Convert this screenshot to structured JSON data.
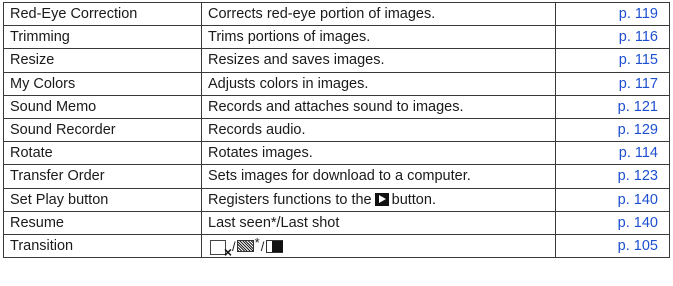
{
  "rows": [
    {
      "function": "Red-Eye Correction",
      "description": "Corrects red-eye portion of images.",
      "page": "p. 119"
    },
    {
      "function": "Trimming",
      "description": "Trims portions of images.",
      "page": "p. 116"
    },
    {
      "function": "Resize",
      "description": "Resizes and saves images.",
      "page": "p. 115"
    },
    {
      "function": "My Colors",
      "description": "Adjusts colors in images.",
      "page": "p. 117"
    },
    {
      "function": "Sound Memo",
      "description": "Records and attaches sound to images.",
      "page": "p. 121"
    },
    {
      "function": "Sound Recorder",
      "description": "Records audio.",
      "page": "p. 129"
    },
    {
      "function": "Rotate",
      "description": "Rotates images.",
      "page": "p. 114"
    },
    {
      "function": "Transfer Order",
      "description": "Sets images for download to a computer.",
      "page": "p. 123"
    },
    {
      "function": "Set Play button",
      "description_before": "Registers functions to the",
      "description_after": "button.",
      "description_icon": "play-button-icon",
      "page": "p. 140"
    },
    {
      "function": "Resume",
      "description": "Last seen*/Last shot",
      "page": "p. 140"
    },
    {
      "function": "Transition",
      "description_icons": [
        "no-transition-icon",
        "fade-transition-icon",
        "slide-transition-icon"
      ],
      "description_separator": "/",
      "description_star": "*",
      "page": "p. 105"
    }
  ],
  "colors": {
    "link": "#1d4fd0",
    "border": "#3a3a3a",
    "text": "#1a1a1a"
  }
}
